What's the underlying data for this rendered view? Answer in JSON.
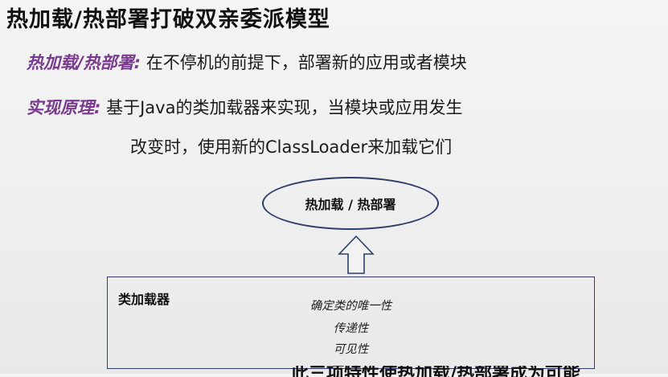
{
  "slide": {
    "title": "热加载/热部署打破双亲委派模型",
    "definition": {
      "label": "热加载/热部署:",
      "text": "在不停机的前提下，部署新的应用或者模块"
    },
    "principle": {
      "label": "实现原理:",
      "text_line1": "基于Java的类加载器来实现，当模块或应用发生",
      "text_line2": "改变时，使用新的ClassLoader来加载它们"
    },
    "diagram": {
      "ellipse_label": "热加载 / 热部署",
      "box_title": "类加载器",
      "properties": [
        "确定类的唯一性",
        "传递性",
        "可见性"
      ]
    },
    "bottom_partial_text": "此三项特性使热加载/热部署成为可能"
  },
  "colors": {
    "title": "#111111",
    "label_purple": "#7a3b8f",
    "diagram_border": "#2f3f6b",
    "background": "#f1f1f1"
  }
}
